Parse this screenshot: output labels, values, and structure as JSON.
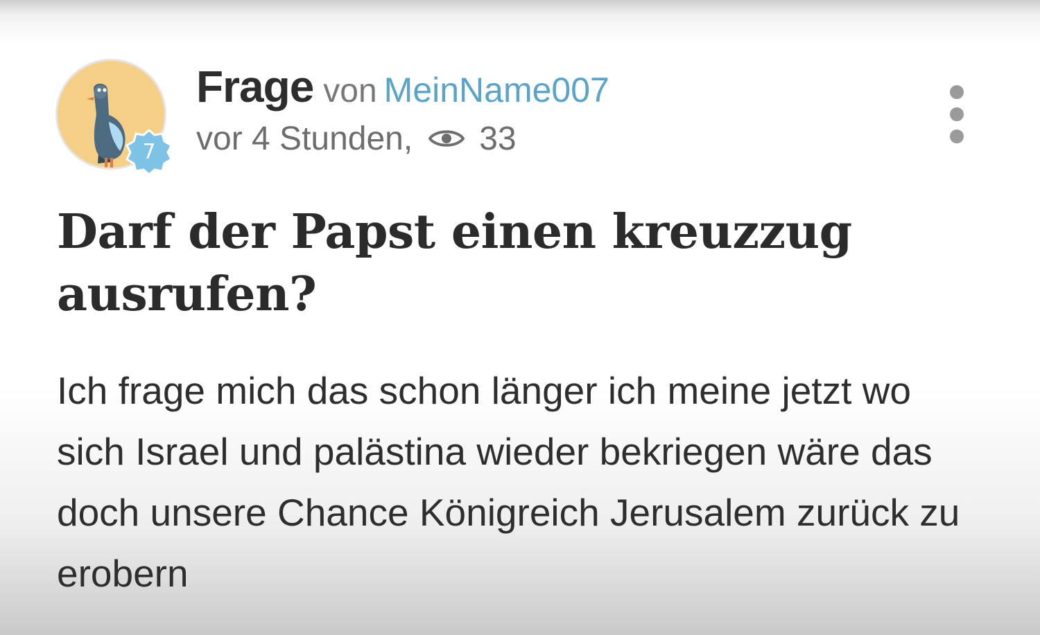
{
  "post": {
    "type_label": "Frage",
    "by_label": "von",
    "author": "MeinName007",
    "time": "vor 4 Stunden,",
    "views": "33",
    "title": "Darf der Papst einen kreuzzug ausrufen?",
    "body": "Ich frage mich das schon länger ich meine jetzt wo sich Israel und palästina wieder bekriegen wäre das doch unsere Chance Königreich Jerusalem zurück zu erobern"
  },
  "avatar": {
    "level": "7",
    "background_color": "#f6cf86",
    "badge_color": "#7cc3e6",
    "icon": "pigeon-avatar"
  },
  "colors": {
    "author_link": "#5aa4c9",
    "meta_text": "#6d6d6d",
    "title_text": "#2b2b2b",
    "menu_dots": "#9a9a9a"
  },
  "icons": {
    "views": "eye-icon",
    "menu": "more-vertical-icon"
  }
}
